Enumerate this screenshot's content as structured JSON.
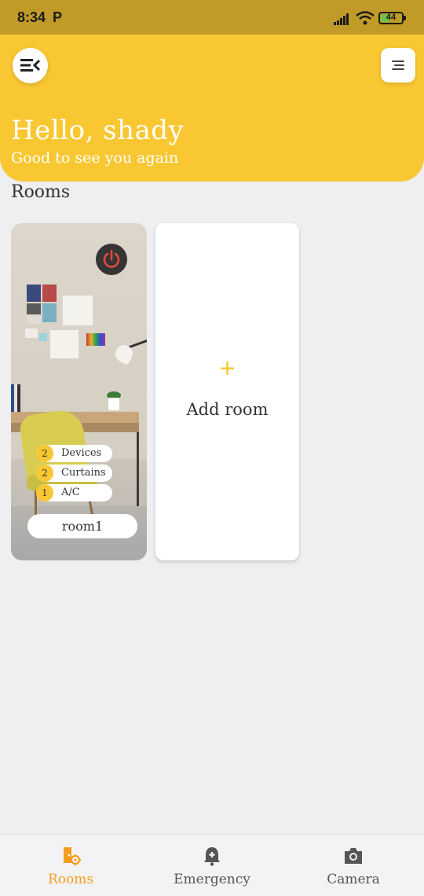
{
  "status_bar": {
    "time": "8:34",
    "notification_icon": "P",
    "battery_level": "44",
    "battery_fraction": 0.44
  },
  "header": {
    "greeting": "Hello, shady",
    "subtitle": "Good to see you again",
    "menu_icon": "menu-collapse-icon",
    "filter_icon": "sort-lines-icon"
  },
  "section_title": "Rooms",
  "rooms": [
    {
      "name": "room1",
      "power_state": "off",
      "stats": [
        {
          "count": "2",
          "label": "Devices"
        },
        {
          "count": "2",
          "label": "Curtains"
        },
        {
          "count": "1",
          "label": "A/C"
        }
      ]
    }
  ],
  "add_room": {
    "icon": "+",
    "label": "Add room"
  },
  "bottom_nav": [
    {
      "label": "Rooms",
      "icon": "room-settings-icon",
      "active": true
    },
    {
      "label": "Emergency",
      "icon": "alarm-bell-icon",
      "active": false
    },
    {
      "label": "Camera",
      "icon": "camera-icon",
      "active": false
    }
  ],
  "colors": {
    "accent": "#f9c732",
    "status_bar": "#c19b28",
    "nav_active": "#f39d1f",
    "power_red": "#e04a3a"
  }
}
